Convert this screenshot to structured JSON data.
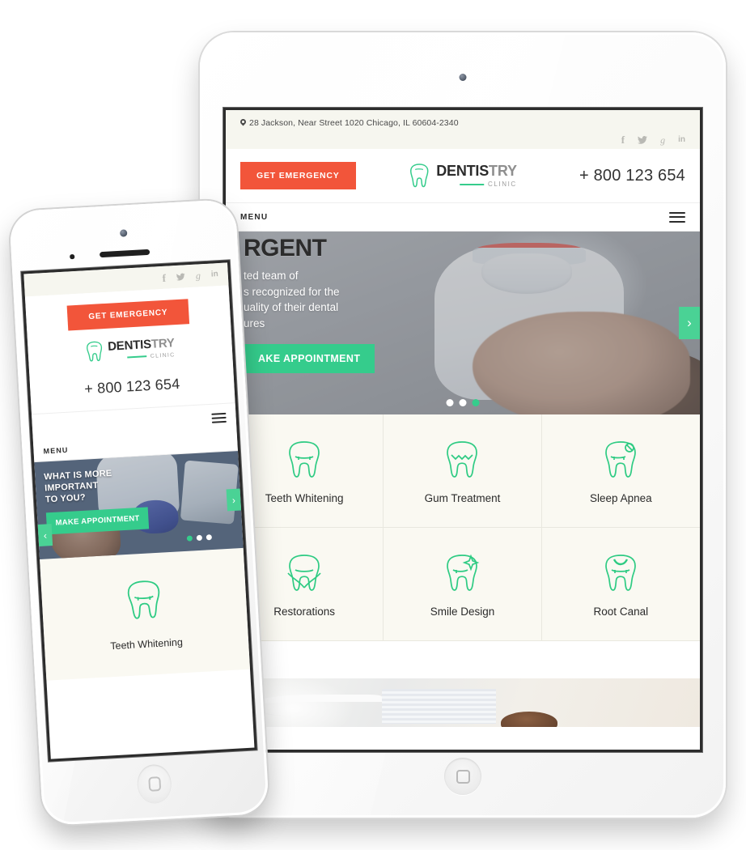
{
  "site": {
    "topbar": {
      "address": "28 Jackson, Near Street 1020 Chicago, IL 60604-2340",
      "pin_icon": "map-pin-icon",
      "socials": [
        {
          "name": "facebook-icon",
          "label": "f"
        },
        {
          "name": "twitter-icon",
          "label": ""
        },
        {
          "name": "google-plus-icon",
          "label": "g"
        },
        {
          "name": "linkedin-icon",
          "label": "in"
        }
      ]
    },
    "header": {
      "emergency_button": "GET EMERGENCY",
      "logo": {
        "icon": "tooth-icon",
        "name_dark": "DENTIS",
        "name_gray": "TRY",
        "subtitle": "CLINIC"
      },
      "phone": "+ 800 123 654"
    },
    "nav": {
      "menu_label": "MENU",
      "burger_icon": "hamburger-menu-icon"
    },
    "hero": {
      "heading": "RGENT",
      "paragraph": "ted team of\ns recognized for the\nuality of their dental\nures",
      "appointment_button": "AKE APPOINTMENT",
      "next_arrow": "›",
      "prev_arrow": "‹",
      "dots": [
        "off",
        "off",
        "on"
      ]
    },
    "services": [
      {
        "label": "Teeth Whitening",
        "icon": "tooth-whitening-icon"
      },
      {
        "label": "Gum Treatment",
        "icon": "tooth-gum-icon"
      },
      {
        "label": "Sleep Apnea",
        "icon": "tooth-apnea-icon"
      },
      {
        "label": "Restorations",
        "icon": "tooth-restoration-icon"
      },
      {
        "label": "Smile Design",
        "icon": "tooth-sparkle-icon"
      },
      {
        "label": "Root Canal",
        "icon": "tooth-root-canal-icon"
      }
    ]
  },
  "mobile": {
    "topbar": {
      "socials": [
        {
          "name": "facebook-icon",
          "label": "f"
        },
        {
          "name": "twitter-icon",
          "label": ""
        },
        {
          "name": "google-plus-icon",
          "label": "g"
        },
        {
          "name": "linkedin-icon",
          "label": "in"
        }
      ]
    },
    "header": {
      "emergency_button": "GET EMERGENCY",
      "logo": {
        "icon": "tooth-icon",
        "name_dark": "DENTIS",
        "name_gray": "TRY",
        "subtitle": "CLINIC"
      },
      "phone": "+ 800 123 654"
    },
    "nav": {
      "menu_label": "MENU",
      "burger_icon": "hamburger-menu-icon"
    },
    "hero": {
      "heading_line1": "WHAT IS MORE IMPORTANT",
      "heading_line2": "TO YOU?",
      "appointment_button": "MAKE APPOINTMENT",
      "next_arrow": "›",
      "prev_arrow": "‹",
      "dots": [
        "on",
        "off",
        "off"
      ]
    },
    "service": {
      "label": "Teeth Whitening",
      "icon": "tooth-whitening-icon"
    }
  },
  "devices": {
    "tablet": {
      "name": "tablet-device",
      "home_button": "home-button",
      "camera": "front-camera"
    },
    "phone": {
      "name": "phone-device",
      "home_button": "home-button",
      "camera": "front-camera",
      "speaker": "earpiece-speaker"
    }
  },
  "colors": {
    "accent_green": "#35cc8c",
    "accent_green_light": "#4ad295",
    "emergency_orange": "#f2553a",
    "cream": "#faf9f2",
    "topbar_cream": "#f6f6ef",
    "text_dark": "#2b2b2b",
    "text_gray": "#8f8f8f"
  }
}
